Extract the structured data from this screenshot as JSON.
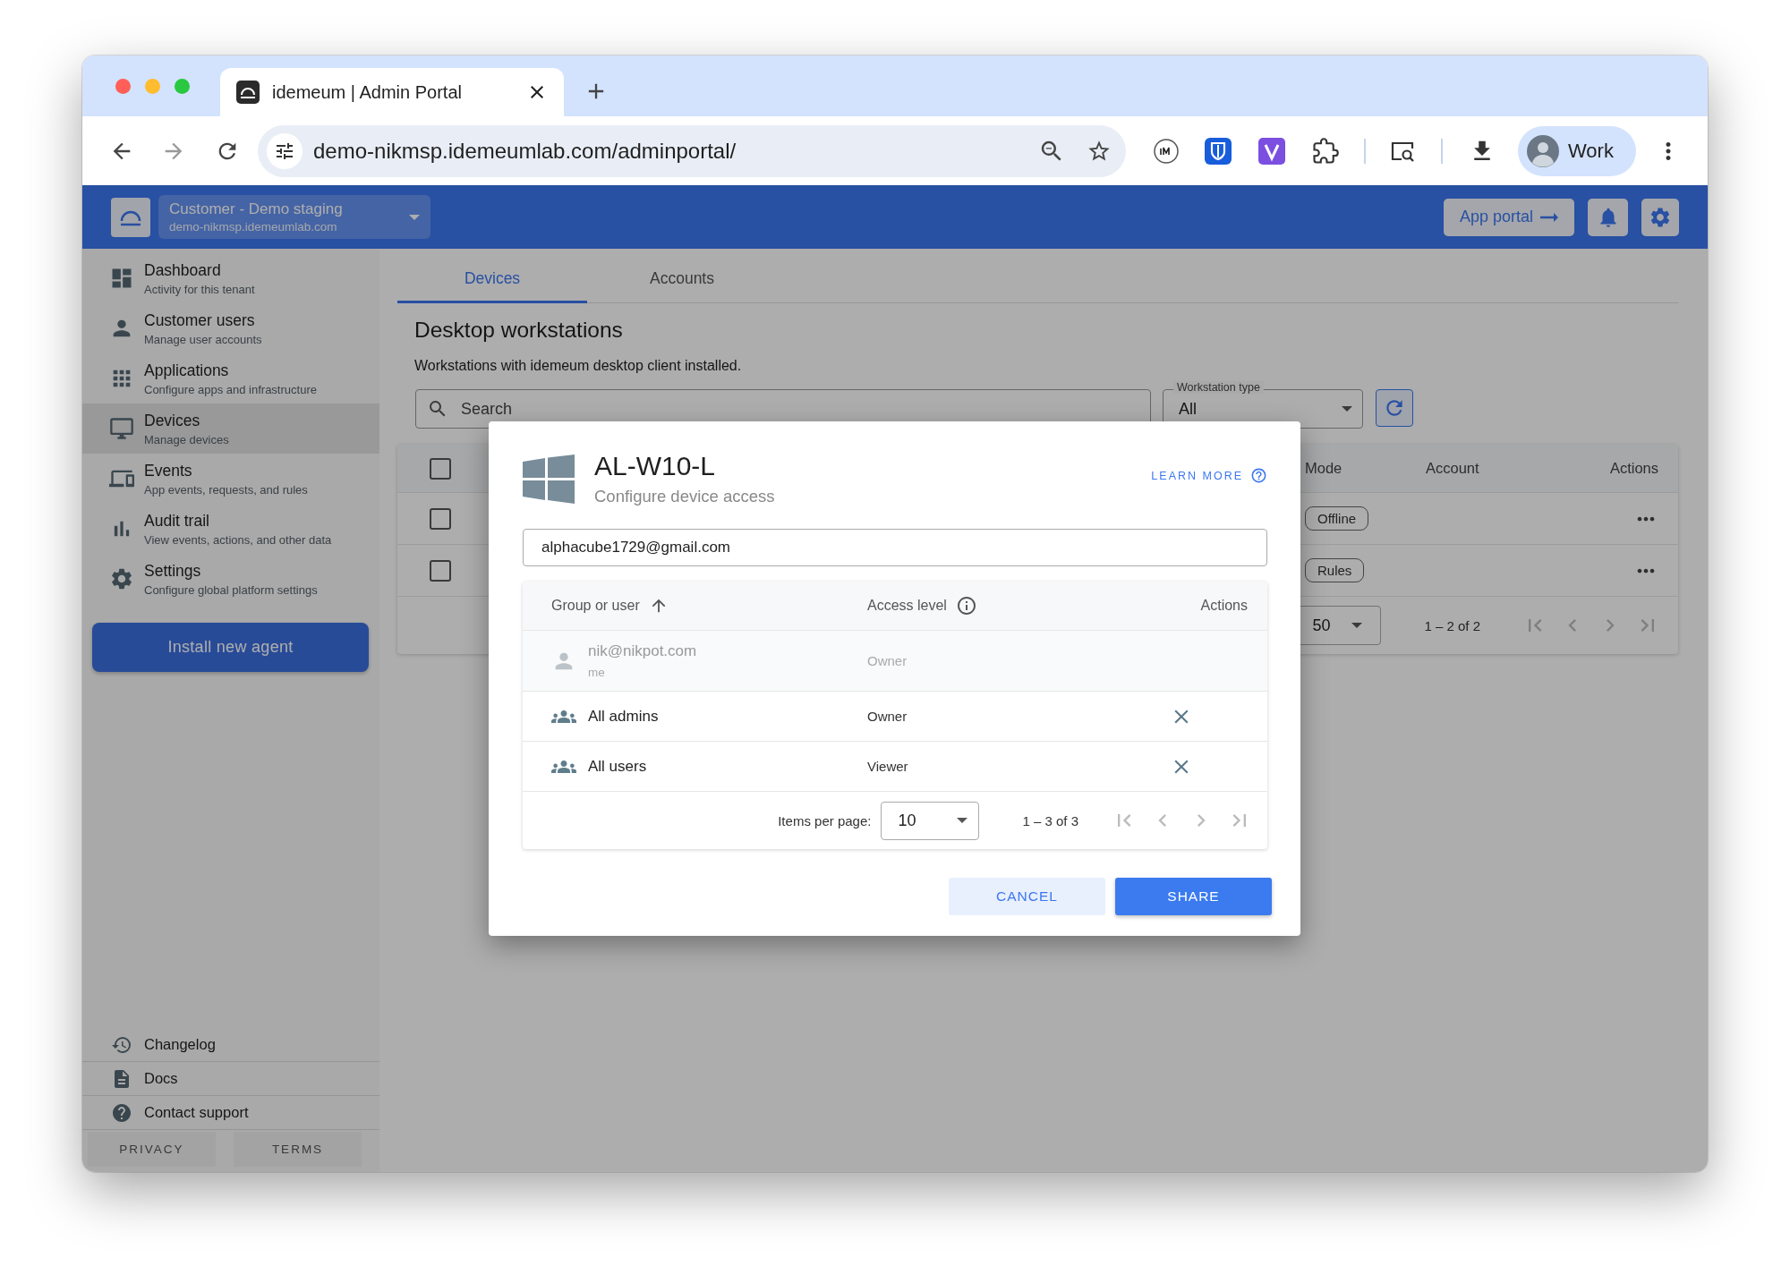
{
  "browser": {
    "tab_title": "idemeum | Admin Portal",
    "url": "demo-nikmsp.idemeumlab.com/adminportal/",
    "profile": "Work"
  },
  "header": {
    "tenant_name": "Customer - Demo staging",
    "tenant_domain": "demo-nikmsp.idemeumlab.com",
    "app_portal": "App portal"
  },
  "sidebar": {
    "items": [
      {
        "title": "Dashboard",
        "subtitle": "Activity for this tenant",
        "selected": false
      },
      {
        "title": "Customer users",
        "subtitle": "Manage user accounts",
        "selected": false
      },
      {
        "title": "Applications",
        "subtitle": "Configure apps and infrastructure",
        "selected": false
      },
      {
        "title": "Devices",
        "subtitle": "Manage devices",
        "selected": true
      },
      {
        "title": "Events",
        "subtitle": "App events, requests, and rules",
        "selected": false
      },
      {
        "title": "Audit trail",
        "subtitle": "View events, actions, and other data",
        "selected": false
      },
      {
        "title": "Settings",
        "subtitle": "Configure global platform settings",
        "selected": false
      }
    ],
    "install_button": "Install new agent",
    "footer_links": [
      "Changelog",
      "Docs",
      "Contact support"
    ],
    "legal": [
      "PRIVACY",
      "TERMS"
    ]
  },
  "main": {
    "tabs": [
      {
        "label": "Devices",
        "selected": true
      },
      {
        "label": "Accounts",
        "selected": false
      }
    ],
    "heading": "Desktop workstations",
    "description": "Workstations with idemeum desktop client installed.",
    "search": {
      "placeholder": "Search"
    },
    "type_filter": {
      "label": "Workstation type",
      "value": "All"
    },
    "table": {
      "all_checked": false,
      "columns": [
        "Mode",
        "Account",
        "Actions"
      ],
      "rows": [
        {
          "checked": false,
          "mode": "Offline"
        },
        {
          "checked": false,
          "mode": "Rules"
        }
      ],
      "page_size": "50",
      "range": "1 – 2 of 2"
    }
  },
  "dialog": {
    "title": "AL-W10-L",
    "subtitle": "Configure device access",
    "learn_more": "LEARN MORE",
    "share_with": "alphacube1729@gmail.com",
    "table": {
      "columns": [
        "Group or user",
        "Access level",
        "Actions"
      ],
      "rows": [
        {
          "kind": "user",
          "name": "nik@nikpot.com",
          "note": "me",
          "access": "Owner",
          "disabled": true
        },
        {
          "kind": "group",
          "name": "All admins",
          "access": "Owner",
          "disabled": false
        },
        {
          "kind": "group",
          "name": "All users",
          "access": "Viewer",
          "disabled": false
        }
      ],
      "items_per_page_label": "Items per page:",
      "page_size": "10",
      "range": "1 – 3 of 3"
    },
    "buttons": {
      "cancel": "CANCEL",
      "share": "SHARE"
    }
  }
}
